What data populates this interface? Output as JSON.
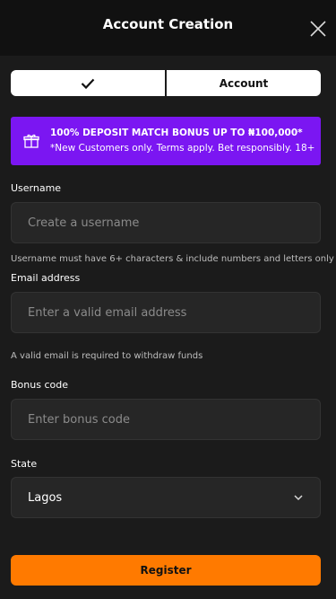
{
  "header": {
    "title": "Account Creation"
  },
  "tabs": {
    "step2_label": "Account"
  },
  "promo": {
    "title": "100% DEPOSIT MATCH BONUS UP TO ₦100,000*",
    "subtitle": "*New Customers only. Terms apply. Bet responsibly. 18+"
  },
  "form": {
    "username": {
      "label": "Username",
      "placeholder": "Create a username",
      "hint": "Username must have 6+ characters & include numbers and letters only"
    },
    "email": {
      "label": "Email address",
      "placeholder": "Enter a valid email address",
      "hint": "A valid email is required to withdraw funds"
    },
    "bonus": {
      "label": "Bonus code",
      "placeholder": "Enter bonus code"
    },
    "state": {
      "label": "State",
      "value": "Lagos"
    }
  },
  "register_label": "Register",
  "colors": {
    "accent": "#ff7a00",
    "promo": "#7b16f2",
    "background": "#1b1b1b"
  },
  "icons": {
    "close": "close-icon",
    "check": "check-icon",
    "gift": "gift-icon",
    "chevron": "chevron-down-icon"
  }
}
